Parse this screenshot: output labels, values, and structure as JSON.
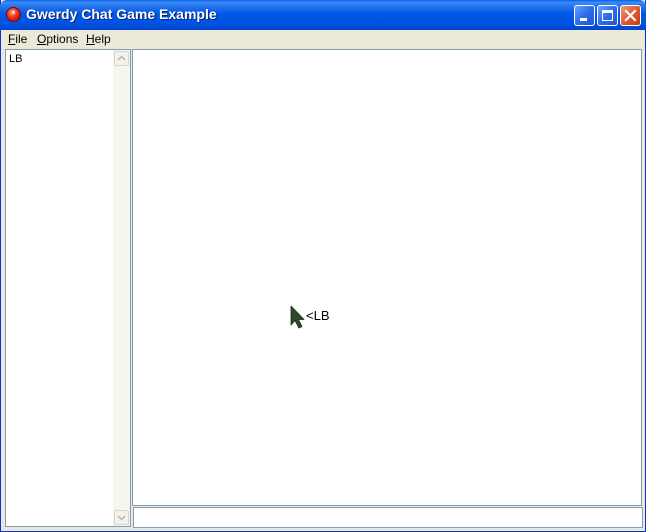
{
  "window": {
    "title": "Gwerdy Chat Game Example",
    "controls": {
      "minimize": "minimize",
      "maximize": "maximize",
      "close": "close"
    },
    "colors": {
      "titlebar": "#0054e3",
      "close_button": "#e05a32",
      "chrome": "#ece9d8",
      "border": "#7f9db9"
    }
  },
  "menubar": {
    "items": [
      {
        "first": "F",
        "rest": "ile"
      },
      {
        "first": "O",
        "rest": "ptions"
      },
      {
        "first": "H",
        "rest": "elp"
      }
    ]
  },
  "players": {
    "items": [
      "LB"
    ]
  },
  "game": {
    "avatar_icon": "arrow-cursor-icon",
    "avatar_label": "<LB"
  },
  "chat": {
    "value": "",
    "placeholder": ""
  }
}
